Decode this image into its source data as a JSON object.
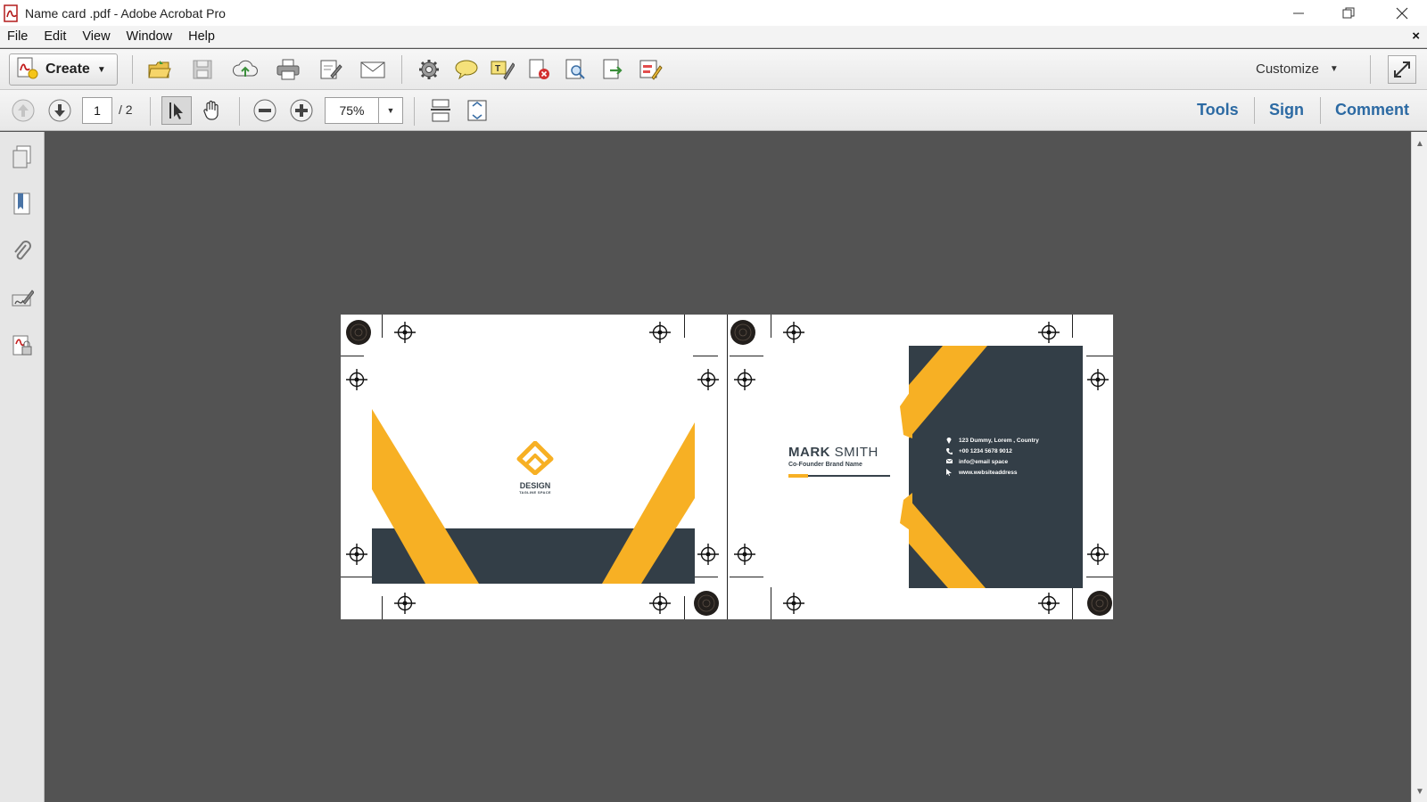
{
  "window": {
    "title": "Name card .pdf - Adobe Acrobat Pro",
    "controls": [
      "minimize",
      "restore",
      "close"
    ]
  },
  "menu": {
    "items": [
      "File",
      "Edit",
      "View",
      "Window",
      "Help"
    ],
    "close_document": "×"
  },
  "toolbar": {
    "create_label": "Create",
    "customize_label": "Customize",
    "icons": [
      "open-folder-icon",
      "save-icon",
      "cloud-upload-icon",
      "print-icon",
      "edit-document-icon",
      "email-icon",
      "settings-gear-icon",
      "comment-bubble-icon",
      "highlight-text-icon",
      "delete-page-icon",
      "page-search-icon",
      "export-icon",
      "form-edit-icon"
    ]
  },
  "navigation": {
    "current_page": "1",
    "total_pages": "/ 2",
    "zoom": "75%"
  },
  "panes": {
    "tools": "Tools",
    "sign": "Sign",
    "comment": "Comment"
  },
  "left_pane_icons": [
    "page-thumbnails-icon",
    "bookmarks-icon",
    "attachments-icon",
    "signatures-icon",
    "security-icon"
  ],
  "document": {
    "front_card": {
      "logo_text": "DESIGN",
      "tagline": "TAGLINE SPACE"
    },
    "back_card": {
      "name_first": "MARK",
      "name_last": "SMITH",
      "role": "Co-Founder Brand Name",
      "contacts": [
        {
          "icon": "location-icon",
          "text": "123 Dummy, Lorem , Country"
        },
        {
          "icon": "phone-icon",
          "text": "+00 1234 5678 9012"
        },
        {
          "icon": "mail-icon",
          "text": "info@email space"
        },
        {
          "icon": "cursor-icon",
          "text": "www.websiteaddress"
        }
      ]
    },
    "colors": {
      "accent": "#f7b024",
      "dark": "#333e47",
      "background": "#535353"
    }
  }
}
